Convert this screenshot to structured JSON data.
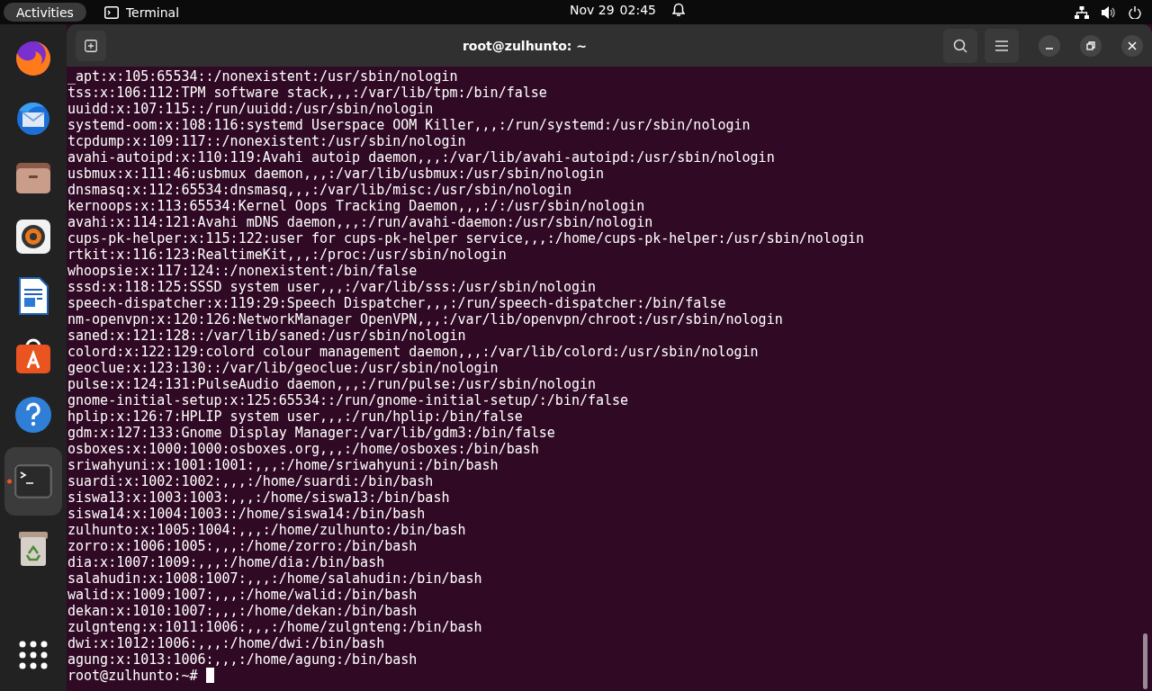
{
  "top_bar": {
    "activities": "Activities",
    "app_name": "Terminal",
    "date": "Nov 29",
    "time": "02:45"
  },
  "dock": [
    {
      "kind": "firefox",
      "active": false
    },
    {
      "kind": "mail",
      "active": false
    },
    {
      "kind": "files",
      "active": false
    },
    {
      "kind": "music",
      "active": false
    },
    {
      "kind": "writer",
      "active": false
    },
    {
      "kind": "store",
      "active": false
    },
    {
      "kind": "help",
      "active": false
    },
    {
      "kind": "terminal",
      "active": true
    },
    {
      "kind": "trash",
      "active": false
    },
    {
      "kind": "apps",
      "active": false
    }
  ],
  "window": {
    "title": "root@zulhunto: ~"
  },
  "terminal": {
    "lines": [
      "_apt:x:105:65534::/nonexistent:/usr/sbin/nologin",
      "tss:x:106:112:TPM software stack,,,:/var/lib/tpm:/bin/false",
      "uuidd:x:107:115::/run/uuidd:/usr/sbin/nologin",
      "systemd-oom:x:108:116:systemd Userspace OOM Killer,,,:/run/systemd:/usr/sbin/nologin",
      "tcpdump:x:109:117::/nonexistent:/usr/sbin/nologin",
      "avahi-autoipd:x:110:119:Avahi autoip daemon,,,:/var/lib/avahi-autoipd:/usr/sbin/nologin",
      "usbmux:x:111:46:usbmux daemon,,,:/var/lib/usbmux:/usr/sbin/nologin",
      "dnsmasq:x:112:65534:dnsmasq,,,:/var/lib/misc:/usr/sbin/nologin",
      "kernoops:x:113:65534:Kernel Oops Tracking Daemon,,,:/:/usr/sbin/nologin",
      "avahi:x:114:121:Avahi mDNS daemon,,,:/run/avahi-daemon:/usr/sbin/nologin",
      "cups-pk-helper:x:115:122:user for cups-pk-helper service,,,:/home/cups-pk-helper:/usr/sbin/nologin",
      "rtkit:x:116:123:RealtimeKit,,,:/proc:/usr/sbin/nologin",
      "whoopsie:x:117:124::/nonexistent:/bin/false",
      "sssd:x:118:125:SSSD system user,,,:/var/lib/sss:/usr/sbin/nologin",
      "speech-dispatcher:x:119:29:Speech Dispatcher,,,:/run/speech-dispatcher:/bin/false",
      "nm-openvpn:x:120:126:NetworkManager OpenVPN,,,:/var/lib/openvpn/chroot:/usr/sbin/nologin",
      "saned:x:121:128::/var/lib/saned:/usr/sbin/nologin",
      "colord:x:122:129:colord colour management daemon,,,:/var/lib/colord:/usr/sbin/nologin",
      "geoclue:x:123:130::/var/lib/geoclue:/usr/sbin/nologin",
      "pulse:x:124:131:PulseAudio daemon,,,:/run/pulse:/usr/sbin/nologin",
      "gnome-initial-setup:x:125:65534::/run/gnome-initial-setup/:/bin/false",
      "hplip:x:126:7:HPLIP system user,,,:/run/hplip:/bin/false",
      "gdm:x:127:133:Gnome Display Manager:/var/lib/gdm3:/bin/false",
      "osboxes:x:1000:1000:osboxes.org,,,:/home/osboxes:/bin/bash",
      "sriwahyuni:x:1001:1001:,,,:/home/sriwahyuni:/bin/bash",
      "suardi:x:1002:1002:,,,:/home/suardi:/bin/bash",
      "siswa13:x:1003:1003:,,,:/home/siswa13:/bin/bash",
      "siswa14:x:1004:1003::/home/siswa14:/bin/bash",
      "zulhunto:x:1005:1004:,,,:/home/zulhunto:/bin/bash",
      "zorro:x:1006:1005:,,,:/home/zorro:/bin/bash",
      "dia:x:1007:1009:,,,:/home/dia:/bin/bash",
      "salahudin:x:1008:1007:,,,:/home/salahudin:/bin/bash",
      "walid:x:1009:1007:,,,:/home/walid:/bin/bash",
      "dekan:x:1010:1007:,,,:/home/dekan:/bin/bash",
      "zulgnteng:x:1011:1006:,,,:/home/zulgnteng:/bin/bash",
      "dwi:x:1012:1006:,,,:/home/dwi:/bin/bash",
      "agung:x:1013:1006:,,,:/home/agung:/bin/bash"
    ],
    "prompt": "root@zulhunto:~#"
  }
}
